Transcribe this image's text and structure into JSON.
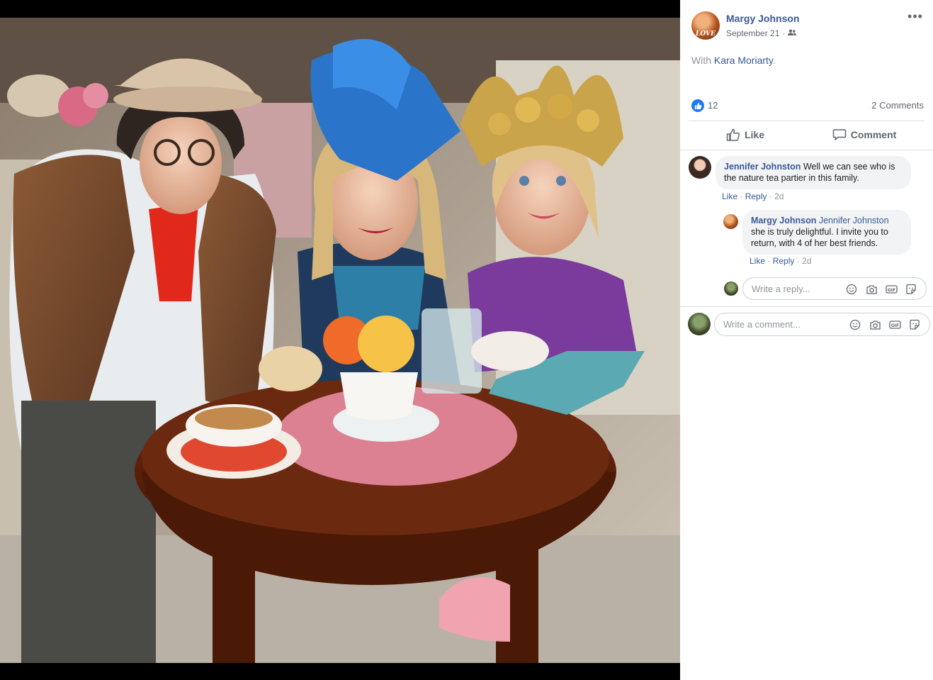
{
  "post": {
    "author": "Margy Johnson",
    "date": "September 21",
    "date_separator": "·",
    "audience_icon": "friends-icon",
    "with_prefix": "With",
    "tagged_person": "Kara Moriarty",
    "tagged_suffix": ".",
    "avatar_text": "LOVE"
  },
  "stats": {
    "like_count": "12",
    "comments_label": "2 Comments"
  },
  "actions": {
    "like_label": "Like",
    "comment_label": "Comment"
  },
  "comments": [
    {
      "author": "Jennifer Johnston",
      "text": "Well we can see who is the nature tea partier in this family.",
      "like": "Like",
      "reply": "Reply",
      "sep": "·",
      "time": "2d"
    },
    {
      "author": "Margy Johnson",
      "mention": "Jennifer Johnston",
      "text": "she is truly delightful. I invite you to return, with 4 of her best friends.",
      "like": "Like",
      "reply": "Reply",
      "sep": "·",
      "time": "2d"
    }
  ],
  "reply_box": {
    "placeholder": "Write a reply..."
  },
  "comment_box": {
    "placeholder": "Write a comment..."
  },
  "colors": {
    "link": "#385898",
    "muted": "#90949c",
    "like_blue": "#2078f4",
    "comment_bg": "#f2f3f5"
  }
}
